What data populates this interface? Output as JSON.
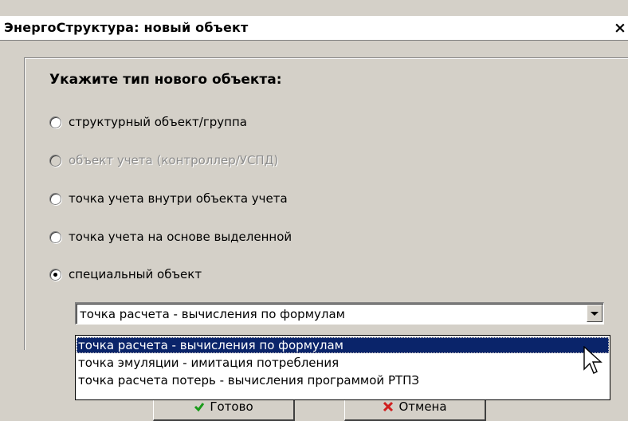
{
  "window": {
    "title": "ЭнергоСтруктура: новый объект",
    "close_glyph": "×",
    "close_icon": "close-icon"
  },
  "form": {
    "heading": "Укажите тип нового объекта:",
    "options": [
      {
        "label": "структурный объект/группа",
        "checked": false,
        "disabled": false
      },
      {
        "label": "объект учета (контроллер/УСПД)",
        "checked": false,
        "disabled": true
      },
      {
        "label": "точка учета внутри объекта учета",
        "checked": false,
        "disabled": false
      },
      {
        "label": "точка учета на основе выделенной",
        "checked": false,
        "disabled": false
      },
      {
        "label": "специальный объект",
        "checked": true,
        "disabled": false
      }
    ]
  },
  "combo": {
    "value": "точка расчета - вычисления по формулам",
    "arrow_icon": "chevron-down-icon",
    "options": [
      {
        "label": "точка расчета - вычисления по формулам",
        "selected": true
      },
      {
        "label": "точка эмуляции - имитация потребления",
        "selected": false
      },
      {
        "label": "точка расчета потерь - вычисления программой РТПЗ",
        "selected": false
      }
    ]
  },
  "buttons": {
    "ok_label": "Готово",
    "ok_icon": "checkmark-icon",
    "cancel_label": "Отмена",
    "cancel_icon": "cross-icon"
  },
  "colors": {
    "dialog_bg": "#d4d0c8",
    "selection": "#0a246a",
    "ok_icon_color": "#1a9b1a",
    "cancel_icon_color": "#d02020"
  }
}
